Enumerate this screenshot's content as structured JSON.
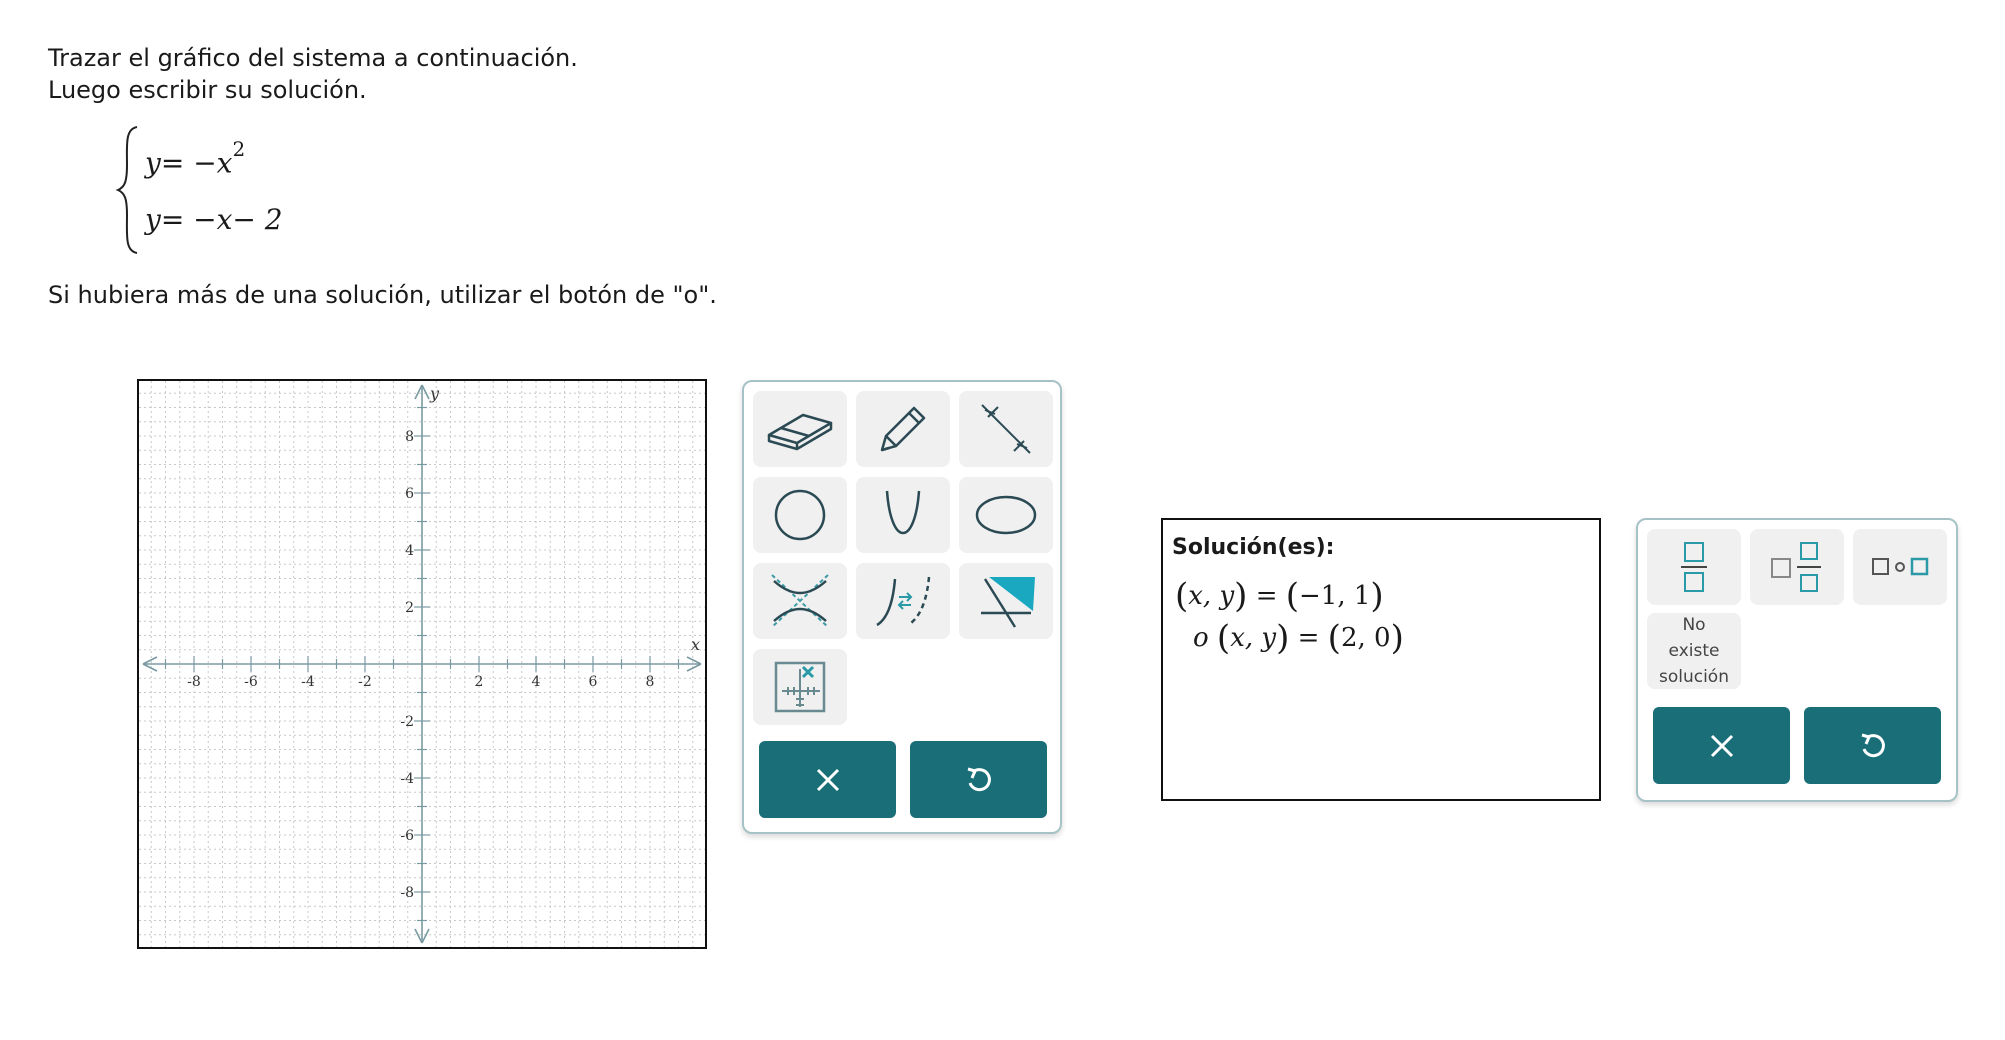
{
  "prompt": {
    "line1": "Trazar el gráfico del sistema a continuación.",
    "line2": "Luego escribir su solución."
  },
  "system": {
    "eq1_lhs": "y",
    "eq1_rhs": "= −x",
    "eq1_exp": "2",
    "eq2": "y= −x− 2"
  },
  "note": "Si hubiera más de una solución, utilizar el botón de \"o\".",
  "graph": {
    "x_axis_label": "x",
    "y_axis_label": "y",
    "x_ticks": [
      "-8",
      "-6",
      "-4",
      "-2",
      "2",
      "4",
      "6",
      "8"
    ],
    "y_ticks": [
      "8",
      "6",
      "4",
      "2",
      "-2",
      "-4",
      "-6",
      "-8"
    ],
    "x_range": [
      -10,
      10
    ],
    "y_range": [
      -10,
      10
    ],
    "grid": true
  },
  "toolbox": {
    "tools": [
      {
        "name": "eraser-icon"
      },
      {
        "name": "pencil-icon"
      },
      {
        "name": "line-icon"
      },
      {
        "name": "circle-icon"
      },
      {
        "name": "parabola-icon"
      },
      {
        "name": "ellipse-icon"
      },
      {
        "name": "hyperbola-icon"
      },
      {
        "name": "inverse-function-icon"
      },
      {
        "name": "shade-region-icon"
      },
      {
        "name": "move-graph-icon"
      }
    ],
    "clear_icon": "close-icon",
    "undo_icon": "undo-icon"
  },
  "solution": {
    "title": "Solución(es):",
    "line1": {
      "lhs": "x, y",
      "equals": "=",
      "rhs": "−1, 1"
    },
    "line2": {
      "prefix": "o",
      "lhs": "x, y",
      "equals": "=",
      "rhs": "2, 0"
    }
  },
  "keypad": {
    "keys": [
      {
        "name": "fraction-icon"
      },
      {
        "name": "mixed-number-icon"
      },
      {
        "name": "or-icon"
      }
    ],
    "no_solution_line1": "No",
    "no_solution_line2": "existe",
    "no_solution_line3": "solución",
    "clear_icon": "close-icon",
    "undo_icon": "undo-icon"
  },
  "colors": {
    "teal": "#196e78",
    "tool_bg": "#f0f0f0",
    "axis": "#7a9aa2",
    "grid": "#c8c8c8"
  }
}
